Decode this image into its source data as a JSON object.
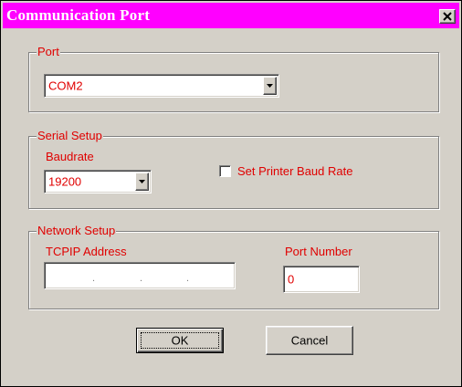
{
  "window": {
    "title": "Communication Port",
    "close_glyph": "×",
    "title_bar_color": "#ff00ff",
    "label_color": "#e00000"
  },
  "port_group": {
    "legend": "Port",
    "port_select": {
      "value": "COM2"
    }
  },
  "serial_group": {
    "legend": "Serial Setup",
    "baudrate_label": "Baudrate",
    "baudrate_select": {
      "value": "19200"
    },
    "set_printer_baud_rate": {
      "label": "Set Printer Baud Rate",
      "checked": false
    }
  },
  "network_group": {
    "legend": "Network Setup",
    "tcpip_label": "TCPIP Address",
    "tcpip_address": {
      "value": "",
      "separator": "."
    },
    "port_number_label": "Port Number",
    "port_number": {
      "value": "0"
    }
  },
  "buttons": {
    "ok_label": "OK",
    "cancel_label": "Cancel"
  }
}
